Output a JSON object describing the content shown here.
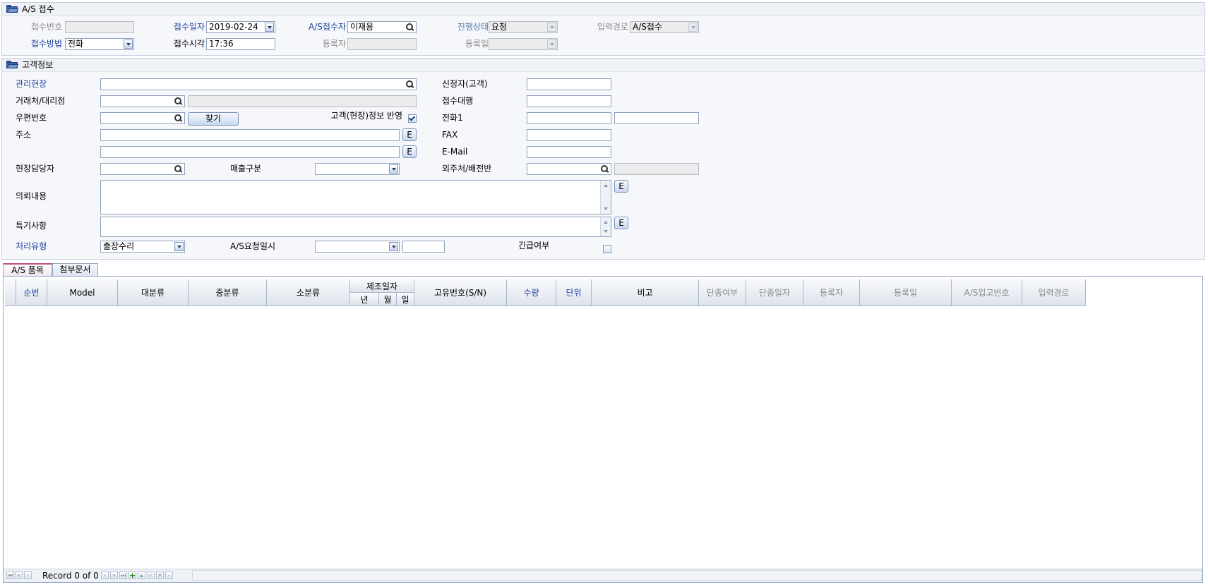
{
  "reception": {
    "title": "A/S 접수",
    "labels": {
      "receipt_no": "접수번호",
      "receipt_date": "접수일자",
      "as_receiver": "A/S접수자",
      "progress": "진행상태",
      "input_path": "입력경로",
      "receipt_method": "접수방법",
      "receipt_time": "접수시각",
      "registrant": "등록자",
      "reg_date": "등록일"
    },
    "values": {
      "receipt_no": "",
      "receipt_date": "2019-02-24",
      "as_receiver": "이재용",
      "progress": "요청",
      "input_path": "A/S접수",
      "receipt_method": "전화",
      "receipt_time": "17:36",
      "registrant": "",
      "reg_date": ""
    }
  },
  "customer": {
    "title": "고객정보",
    "labels": {
      "site": "관리현장",
      "dealer": "거래처/대리점",
      "postal": "우편번호",
      "address": "주소",
      "site_manager": "현장담당자",
      "sales_type": "매출구분",
      "request": "의뢰내용",
      "notes": "특기사항",
      "process_type": "처리유형",
      "as_request_dt": "A/S요청일시",
      "urgent": "긴급여부",
      "applicant": "신청자(고객)",
      "agent": "접수대행",
      "phone1": "전화1",
      "fax": "FAX",
      "email": "E-Mail",
      "subcontractor": "외주처/배전반",
      "reflect": "고객(현장)정보 반영"
    },
    "values": {
      "process_type": "출장수리"
    },
    "find_button": "찾기",
    "e_button": "E"
  },
  "tabs": [
    "A/S 품목",
    "첨부문서"
  ],
  "grid": {
    "headers": {
      "seq": "순번",
      "model": "Model",
      "major": "대분류",
      "middle": "중분류",
      "minor": "소분류",
      "mfg_date": "제조일자",
      "year": "년",
      "month": "월",
      "day": "일",
      "serial": "고유번호(S/N)",
      "qty": "수량",
      "unit": "단위",
      "remark": "비고",
      "discontinued": "단종여부",
      "disc_date": "단종일자",
      "registrant": "등록자",
      "reg_date": "등록일",
      "as_in_no": "A/S입고번호",
      "input_path": "입력경로"
    },
    "record_text": "Record 0 of 0"
  },
  "icons": [
    "folder-icon",
    "search-icon",
    "chevron-down-icon",
    "checkbox-icon",
    "first-icon",
    "prev-page-icon",
    "prev-icon",
    "next-icon",
    "next-page-icon",
    "last-icon",
    "add-icon",
    "up-icon",
    "save-icon",
    "delete-icon"
  ]
}
